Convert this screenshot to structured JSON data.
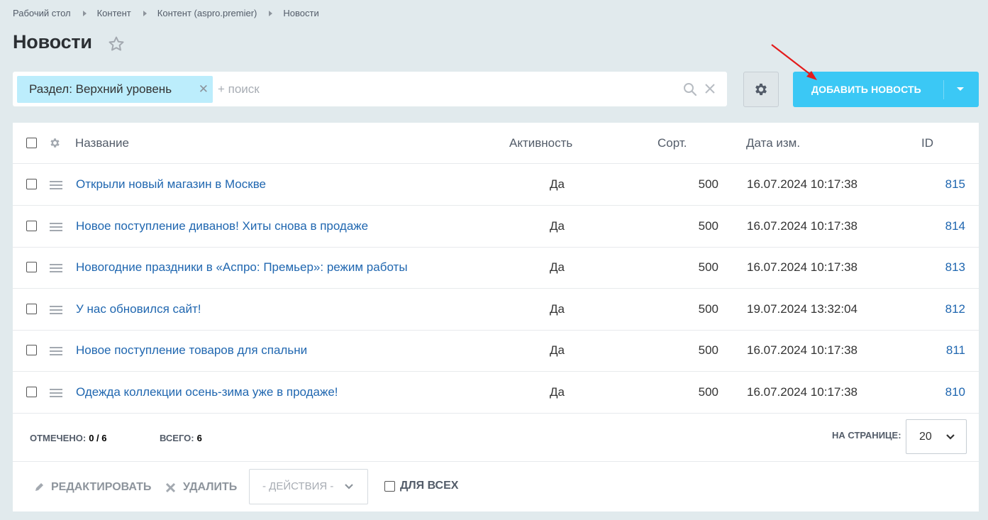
{
  "breadcrumb": [
    "Рабочий стол",
    "Контент",
    "Контент (aspro.premier)",
    "Новости"
  ],
  "page": {
    "title": "Новости"
  },
  "filter": {
    "chip_label": "Раздел: Верхний уровень",
    "placeholder": "+ поиск"
  },
  "add_button": {
    "label": "ДОБАВИТЬ НОВОСТЬ"
  },
  "grid": {
    "columns": {
      "name": "Название",
      "active": "Активность",
      "sort": "Сорт.",
      "date": "Дата изм.",
      "id": "ID"
    },
    "rows": [
      {
        "name": "Открыли новый магазин в Москве",
        "active": "Да",
        "sort": "500",
        "date": "16.07.2024 10:17:38",
        "id": "815"
      },
      {
        "name": "Новое поступление диванов! Хиты снова в продаже",
        "active": "Да",
        "sort": "500",
        "date": "16.07.2024 10:17:38",
        "id": "814"
      },
      {
        "name": "Новогодние праздники в «Аспро: Премьер»: режим работы",
        "active": "Да",
        "sort": "500",
        "date": "16.07.2024 10:17:38",
        "id": "813"
      },
      {
        "name": "У нас обновился сайт!",
        "active": "Да",
        "sort": "500",
        "date": "19.07.2024 13:32:04",
        "id": "812"
      },
      {
        "name": "Новое поступление товаров для спальни",
        "active": "Да",
        "sort": "500",
        "date": "16.07.2024 10:17:38",
        "id": "811"
      },
      {
        "name": "Одежда коллекции осень-зима уже в продаже!",
        "active": "Да",
        "sort": "500",
        "date": "16.07.2024 10:17:38",
        "id": "810"
      }
    ]
  },
  "footer": {
    "selected_label": "ОТМЕЧЕНО:",
    "selected_value": "0 / 6",
    "total_label": "ВСЕГО:",
    "total_value": "6",
    "per_page_label": "НА СТРАНИЦЕ:",
    "per_page_value": "20"
  },
  "actions": {
    "edit": "РЕДАКТИРОВАТЬ",
    "delete": "УДАЛИТЬ",
    "select": "- ДЕЙСТВИЯ -",
    "for_all": "ДЛЯ ВСЕХ"
  },
  "colors": {
    "accent": "#3bc8f5",
    "link": "#2067b0",
    "chip": "#bcedfc",
    "background": "#e1eaed",
    "annotation_arrow": "#e31b1b"
  },
  "icons": [
    "star-icon",
    "search-icon",
    "close-icon",
    "gear-icon",
    "chevron-down-icon",
    "drag-handle-icon",
    "pencil-icon",
    "delete-icon"
  ]
}
